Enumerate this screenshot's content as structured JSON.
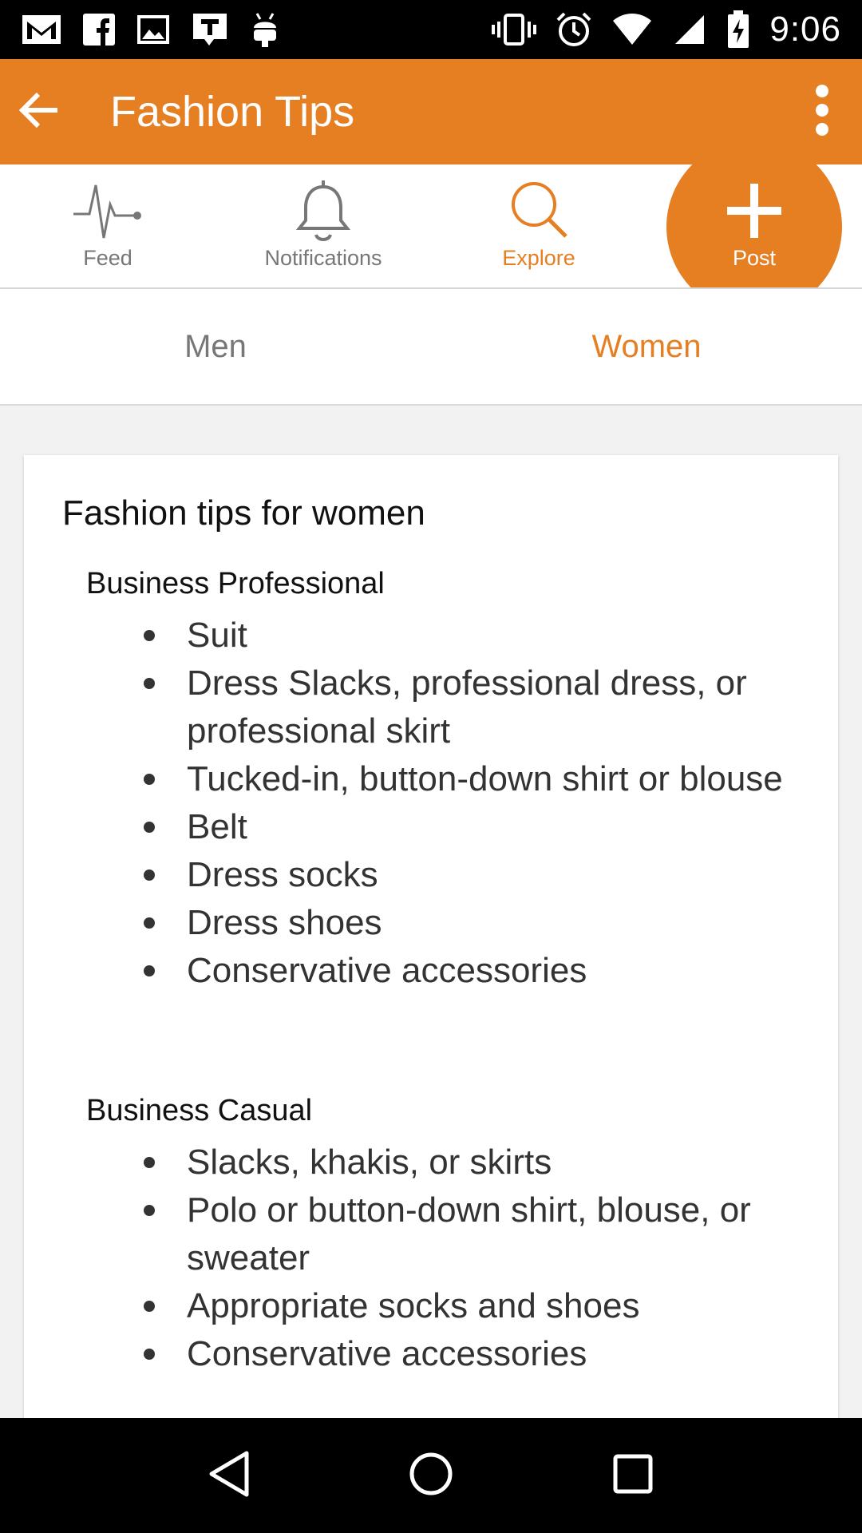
{
  "status_bar": {
    "time": "9:06",
    "left_icons": [
      "gmail-icon",
      "facebook-icon",
      "image-icon",
      "t-app-icon",
      "android-icon"
    ],
    "right_icons": [
      "vibrate-icon",
      "alarm-icon",
      "wifi-icon",
      "signal-icon",
      "battery-charging-icon"
    ]
  },
  "app_bar": {
    "title": "Fashion Tips",
    "color": "#E67E22"
  },
  "nav_tabs": [
    {
      "label": "Feed",
      "icon": "pulse-icon",
      "active": false
    },
    {
      "label": "Notifications",
      "icon": "bell-icon",
      "active": false
    },
    {
      "label": "Explore",
      "icon": "search-icon",
      "active": true
    },
    {
      "label": "Post",
      "icon": "plus-icon",
      "active": false
    }
  ],
  "segment_tabs": [
    {
      "label": "Men",
      "active": false
    },
    {
      "label": "Women",
      "active": true
    }
  ],
  "card": {
    "title": "Fashion tips for women",
    "sections": [
      {
        "heading": "Business Professional",
        "items": [
          "Suit",
          "Dress Slacks, professional dress, or professional skirt",
          "Tucked-in, button-down shirt or blouse",
          "Belt",
          "Dress socks",
          "Dress shoes",
          "Conservative accessories"
        ]
      },
      {
        "heading": "Business Casual",
        "items": [
          "Slacks, khakis, or skirts",
          "Polo or button-down shirt, blouse, or sweater",
          "Appropriate socks and shoes",
          "Conservative accessories"
        ]
      }
    ]
  },
  "system_nav": [
    "back-triangle-icon",
    "home-circle-icon",
    "recents-square-icon"
  ],
  "colors": {
    "accent": "#E67E22",
    "inactive_text": "#777777",
    "body_text": "#333333"
  }
}
